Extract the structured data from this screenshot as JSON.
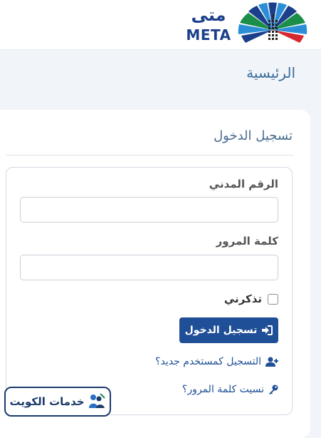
{
  "brand": {
    "logo_arabic": "متى",
    "logo_english": "META"
  },
  "page": {
    "title": "الرئيسية"
  },
  "login": {
    "heading": "تسجيل الدخول",
    "civil_id_label": "الرقم المدني",
    "civil_id_value": "",
    "password_label": "كلمة المرور",
    "password_value": "",
    "remember_label": "تذكرني",
    "remember_checked": false,
    "submit_label": "تسجيل الدخول",
    "register_link": "التسجيل كمستخدم جديد؟",
    "forgot_link": "نسيت كلمة المرور؟"
  },
  "watermark": {
    "text": "خدمات الكويت"
  },
  "colors": {
    "brand_blue": "#1b3f8b",
    "button_blue": "#1f4f96",
    "title_blue": "#3b6c9c",
    "page_bg": "#f1f5f9"
  },
  "icons": {
    "submit": "sign-in-icon",
    "register": "user-plus-icon",
    "forgot": "key-icon"
  }
}
